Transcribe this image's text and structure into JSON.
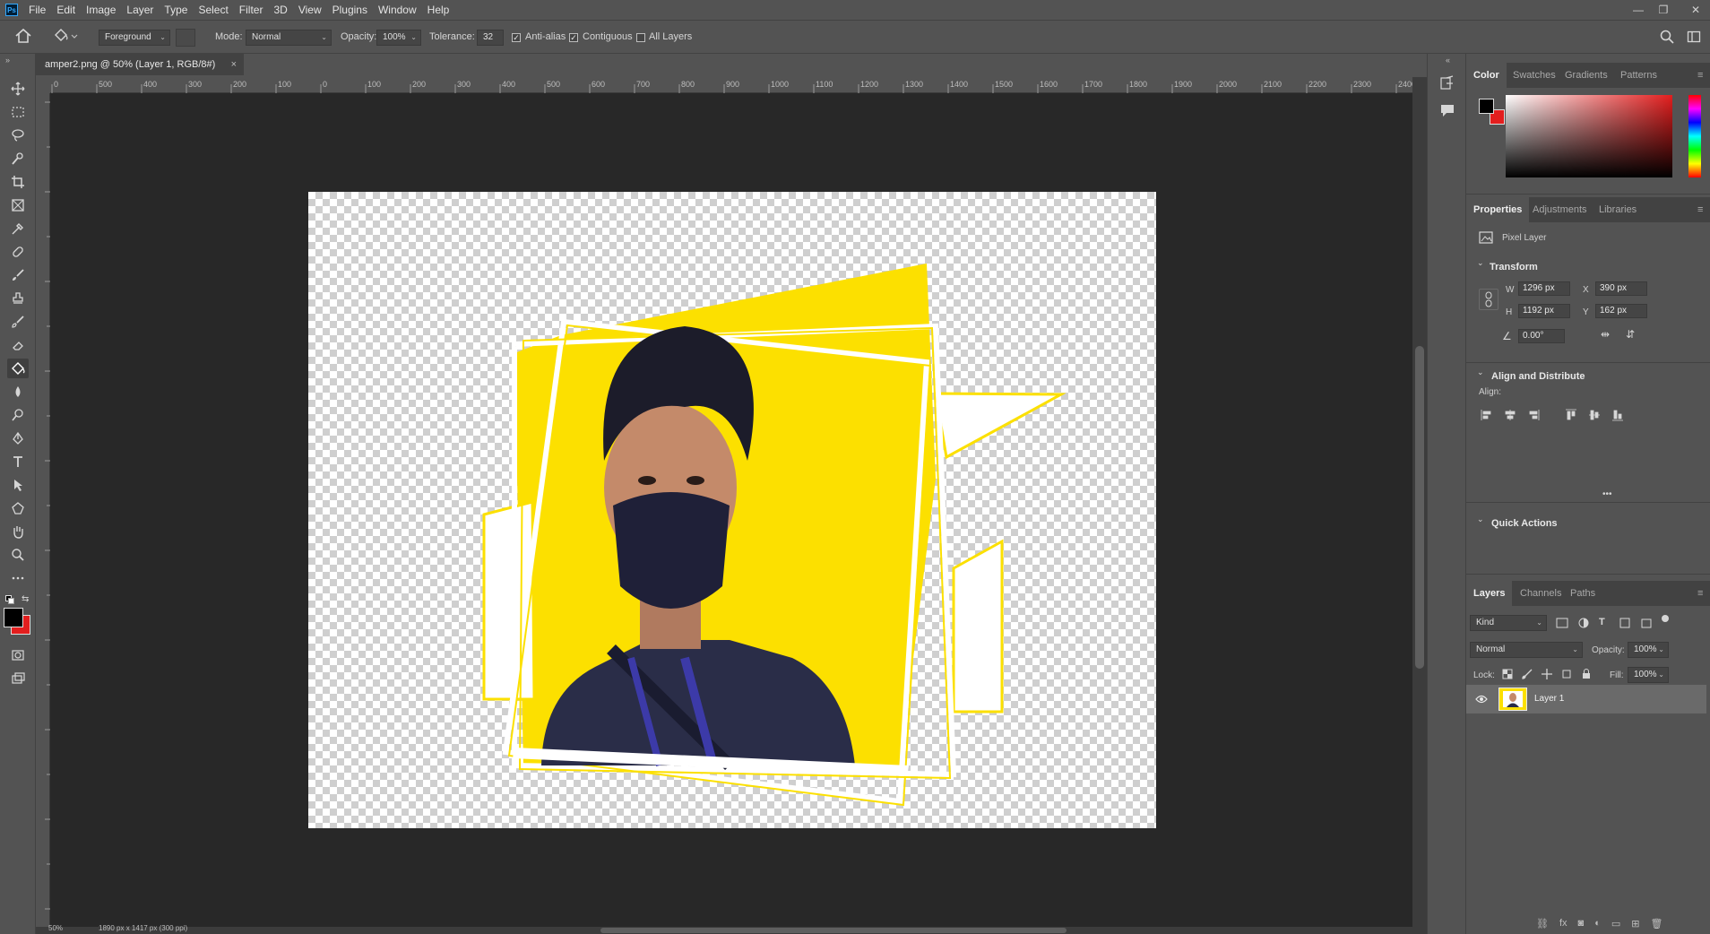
{
  "app": {
    "logo": "Ps"
  },
  "menu": [
    "File",
    "Edit",
    "Image",
    "Layer",
    "Type",
    "Select",
    "Filter",
    "3D",
    "View",
    "Plugins",
    "Window",
    "Help"
  ],
  "window_controls": {
    "minimize": "—",
    "restore": "❐",
    "close": "✕"
  },
  "options": {
    "fill_source": "Foreground",
    "mode_label": "Mode:",
    "mode_value": "Normal",
    "opacity_label": "Opacity:",
    "opacity_value": "100%",
    "tolerance_label": "Tolerance:",
    "tolerance_value": "32",
    "antialias_label": "Anti-alias",
    "antialias_checked": true,
    "contiguous_label": "Contiguous",
    "contiguous_checked": true,
    "all_layers_label": "All Layers",
    "all_layers_checked": false
  },
  "document": {
    "tab_title": "amper2.png @ 50% (Layer 1, RGB/8#)",
    "tab_close": "×",
    "ruler_top": [
      "0",
      "500",
      "400",
      "300",
      "200",
      "100",
      "0",
      "100",
      "200",
      "300",
      "400",
      "500",
      "600",
      "700",
      "800",
      "900",
      "1000",
      "1100",
      "1200",
      "1300",
      "1400",
      "1500",
      "1600",
      "1700",
      "1800",
      "1900",
      "2000",
      "2100",
      "2200",
      "2300",
      "2400"
    ],
    "zoom": "50%",
    "doc_size": "1890 px x 1417 px (300 ppi)"
  },
  "color_panel": {
    "tabs": [
      "Color",
      "Swatches",
      "Gradients",
      "Patterns"
    ],
    "active_tab": "Color",
    "foreground": "#000000",
    "background": "#e31e1e",
    "hue_color": "#e31e1e"
  },
  "properties_panel": {
    "tabs": [
      "Properties",
      "Adjustments",
      "Libraries"
    ],
    "active_tab": "Properties",
    "layer_type": "Pixel Layer",
    "transform_title": "Transform",
    "w_label": "W",
    "w_value": "1296 px",
    "h_label": "H",
    "h_value": "1192 px",
    "x_label": "X",
    "x_value": "390 px",
    "y_label": "Y",
    "y_value": "162 px",
    "angle_value": "0.00°",
    "align_title": "Align and Distribute",
    "align_label": "Align:",
    "more": "•••",
    "quick_actions_title": "Quick Actions"
  },
  "layers_panel": {
    "tabs": [
      "Layers",
      "Channels",
      "Paths"
    ],
    "active_tab": "Layers",
    "filter_kind": "Kind",
    "blend_mode": "Normal",
    "opacity_label": "Opacity:",
    "opacity_value": "100%",
    "lock_label": "Lock:",
    "fill_label": "Fill:",
    "fill_value": "100%",
    "layers": [
      {
        "name": "Layer 1",
        "visible": true,
        "selected": true
      }
    ]
  },
  "colors": {
    "accent_yellow": "#fce000",
    "panel_bg": "#535353",
    "canvas_bg": "#282828"
  }
}
